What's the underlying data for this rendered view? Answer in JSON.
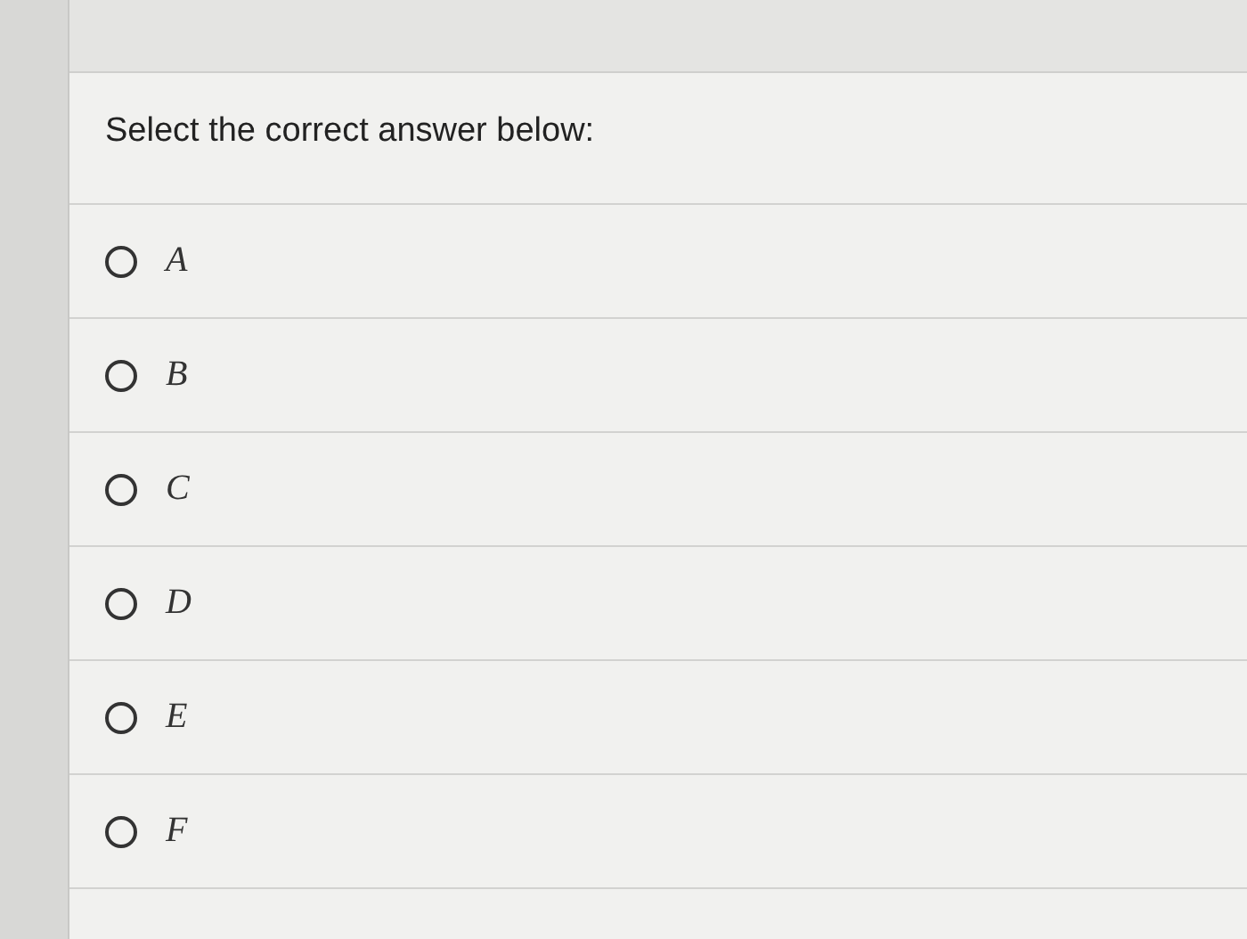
{
  "question": {
    "prompt": "Select the correct answer below:"
  },
  "options": [
    {
      "label": "A",
      "selected": false
    },
    {
      "label": "B",
      "selected": false
    },
    {
      "label": "C",
      "selected": false
    },
    {
      "label": "D",
      "selected": false
    },
    {
      "label": "E",
      "selected": false
    },
    {
      "label": "F",
      "selected": false
    }
  ]
}
